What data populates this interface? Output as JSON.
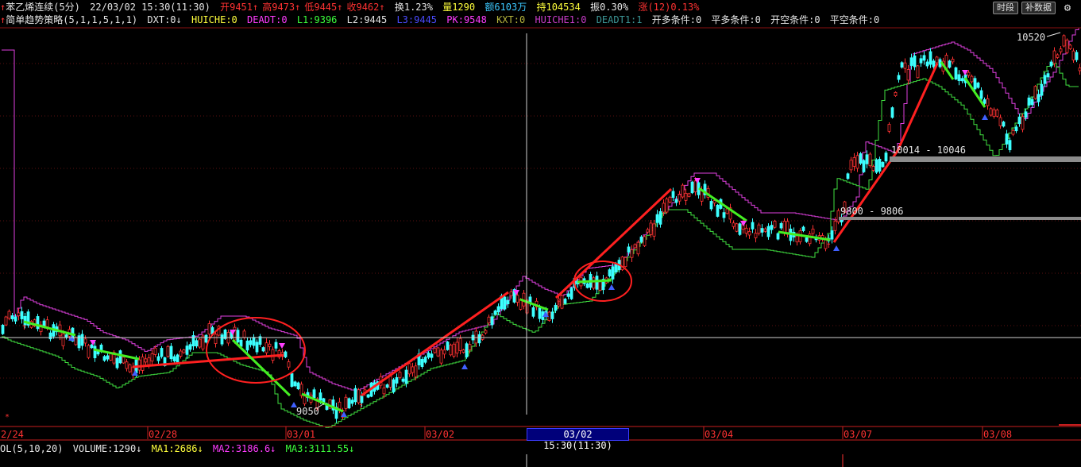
{
  "header": {
    "arrow": "↑",
    "title": "苯乙烯连续(5分)",
    "datetime": "22/03/02 15:30(11:30)",
    "open": "开9451↑",
    "high": "高9473↑",
    "low": "低9445↑",
    "close": "收9462↑",
    "turnover": "换1.23%",
    "volume": "量1290",
    "amount": "额6103万",
    "hold": "持104534",
    "amplitude": "振0.30%",
    "change": "涨(12)0.13%"
  },
  "buttons": {
    "period": "时段",
    "supplement": "补数据",
    "settings_icon": "gear-icon"
  },
  "indicator": {
    "marker": "↑",
    "name": "简单趋势策略(5,1,1,5,1,1)",
    "dxt": "DXT:0↓",
    "huiche": "HUICHE:0",
    "deadt": "DEADT:0",
    "l1": "L1:9396",
    "l2": "L2:9445",
    "l3": "L3:9445",
    "pk": "PK:9548",
    "kxt": "KXT:0",
    "huiche1": "HUICHE1:0",
    "deadt1": "DEADT1:1",
    "kd": "开多条件:0",
    "pd": "平多条件:0",
    "kk": "开空条件:0",
    "pk2": "平空条件:0"
  },
  "price_labels": {
    "high": "10520",
    "low": "9050",
    "zone1": "10014 - 10046",
    "zone2": "9800 - 9806"
  },
  "dates": [
    "2/24",
    "02/28",
    "03/01",
    "03/02",
    "03/04",
    "03/07",
    "03/08"
  ],
  "cursor_label": "03/02 15:30(11:30)",
  "volume_header": {
    "name": "OL(5,10,20)",
    "volume": "VOLUME:1290↓",
    "ma1": "MA1:2686↓",
    "ma2": "MA2:3186.6↓",
    "ma3": "MA3:3111.55↓"
  },
  "colors": {
    "up": "#ff3232",
    "down": "#3cffff",
    "trend_up": "#ff2020",
    "trend_down": "#44ee22",
    "band_upper": "#e040e0",
    "band_lower": "#40e040"
  },
  "chart_data": {
    "type": "candlestick",
    "price_high": 10520,
    "price_low": 9050,
    "zones": [
      {
        "range": [
          10014,
          10046
        ]
      },
      {
        "range": [
          9800,
          9806
        ]
      }
    ],
    "cursor": "03/02 15:30(11:30)"
  }
}
